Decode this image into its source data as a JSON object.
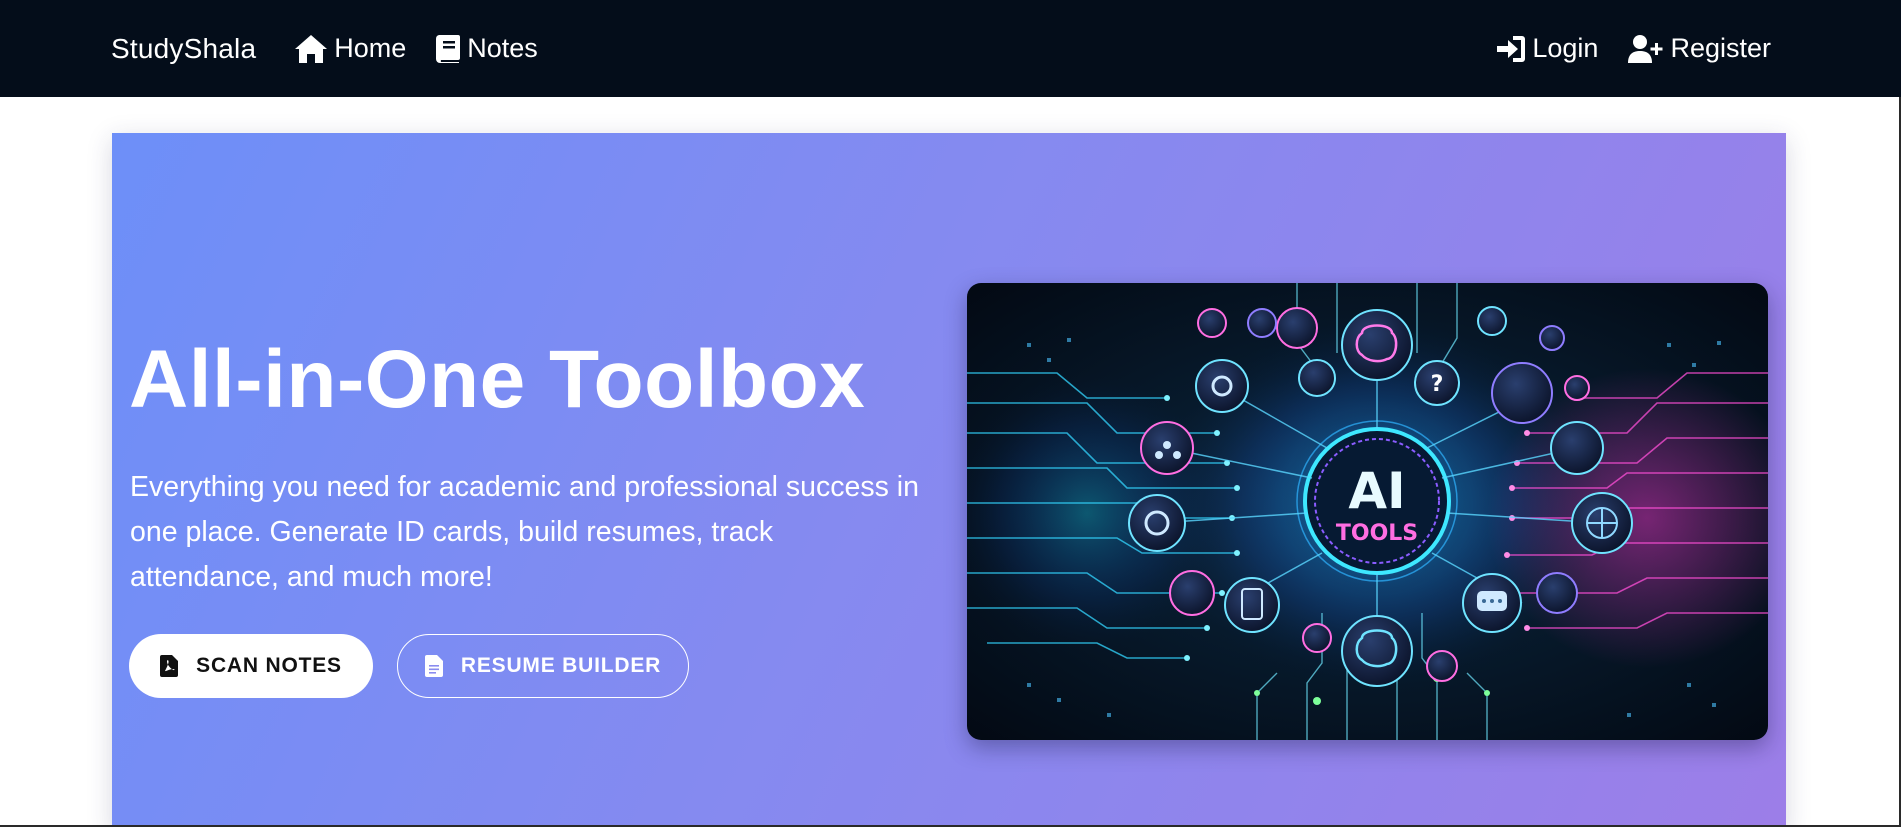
{
  "nav": {
    "brand": "StudySha​la",
    "links_left": [
      {
        "label": "Home",
        "icon": "home-icon"
      },
      {
        "label": "Notes",
        "icon": "book-icon"
      }
    ],
    "links_right": [
      {
        "label": "Login",
        "icon": "sign-in-icon"
      },
      {
        "label": "Register",
        "icon": "user-plus-icon"
      }
    ]
  },
  "hero": {
    "title": "All-in-One Toolbox",
    "description": "Everything you need for academic and professional success in one place. Generate ID cards, build resumes, track attendance, and much more!",
    "buttons": {
      "scan_notes": {
        "label": "SCAN NOTES",
        "icon": "file-pdf-icon"
      },
      "resume_builder": {
        "label": "RESUME BUILDER",
        "icon": "file-icon"
      }
    },
    "art": {
      "line1": "AI",
      "line2": "TOOLS"
    }
  },
  "colors": {
    "navbar_bg": "#040d1a",
    "hero_gradient_start": "#6d8ff8",
    "hero_gradient_end": "#9c7ee8",
    "art_cyan": "#3ee8ff",
    "art_magenta": "#ff3fd2"
  }
}
